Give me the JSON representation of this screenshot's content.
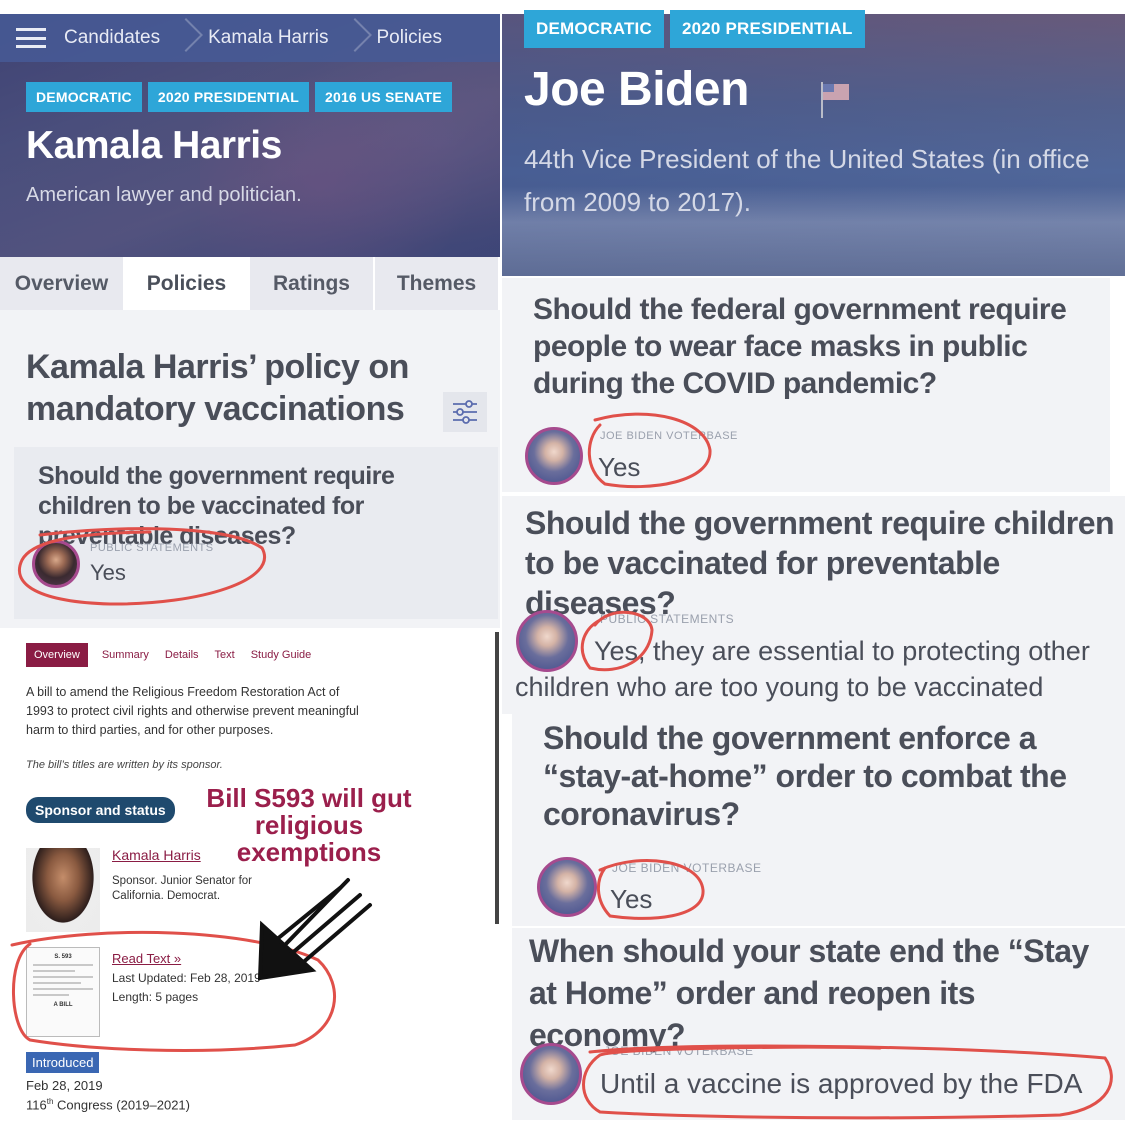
{
  "harris": {
    "breadcrumb": [
      "Candidates",
      "Kamala Harris",
      "Policies"
    ],
    "tags": [
      "DEMOCRATIC",
      "2020 PRESIDENTIAL",
      "2016 US SENATE"
    ],
    "name": "Kamala Harris",
    "description": "American lawyer and politician.",
    "tabs": [
      "Overview",
      "Policies",
      "Ratings",
      "Themes"
    ],
    "active_tab": "Policies",
    "policy_title": "Kamala Harris’ policy on mandatory vaccinations",
    "question": "Should the government require children to be vaccinated for preventable diseases?",
    "source": "PUBLIC STATEMENTS",
    "answer": "Yes"
  },
  "bill": {
    "tabs": [
      "Overview",
      "Summary",
      "Details",
      "Text",
      "Study Guide"
    ],
    "active_tab": "Overview",
    "description": "A bill to amend the Religious Freedom Restoration Act of 1993 to protect civil rights and otherwise prevent meaningful harm to third parties, and for other purposes.",
    "note": "The bill’s titles are written by its sponsor.",
    "sponsor_badge": "Sponsor and status",
    "callout": "Bill S593 will gut religious exemptions",
    "sponsor_name": "Kamala Harris",
    "sponsor_role": "Sponsor. Junior Senator for California. Democrat.",
    "thumb_title": "S. 593",
    "thumb_footer": "A BILL",
    "read_text": "Read Text »",
    "last_updated": "Last Updated: Feb 28, 2019",
    "length": "Length: 5 pages",
    "status": "Introduced",
    "date": "Feb 28, 2019",
    "congress_num": "116",
    "congress_sup": "th",
    "congress_rest": " Congress (2019–2021)"
  },
  "biden": {
    "tags": [
      "DEMOCRATIC",
      "2020 PRESIDENTIAL"
    ],
    "name": "Joe Biden",
    "description": "44th Vice President of the United States (in office from 2009 to 2017).",
    "questions": [
      {
        "q": "Should the federal government require people to wear face masks in public during the COVID pandemic?",
        "source": "JOE BIDEN VOTERBASE",
        "answer": "Yes"
      },
      {
        "q": "Should the government require children to be vaccinated for preventable diseases?",
        "source": "PUBLIC STATEMENTS",
        "answer": "Yes, they are essential to protecting other",
        "answer_cont": "children who are too young to be vaccinated"
      },
      {
        "q": "Should the government enforce a “stay-at-home” order to combat the coronavirus?",
        "source": "JOE BIDEN VOTERBASE",
        "answer": "Yes"
      },
      {
        "q": "When should your state end the “Stay at Home” order and reopen its economy?",
        "source": "JOE BIDEN VOTERBASE",
        "answer": "Until a vaccine is approved by the FDA"
      }
    ]
  },
  "colors": {
    "tag_blue": "#2ea6d8",
    "bill_maroon": "#8a1c44",
    "annotation_red": "#e0504a",
    "sponsor_badge": "#1f4a6e",
    "introduced_blue": "#3a67b3"
  }
}
